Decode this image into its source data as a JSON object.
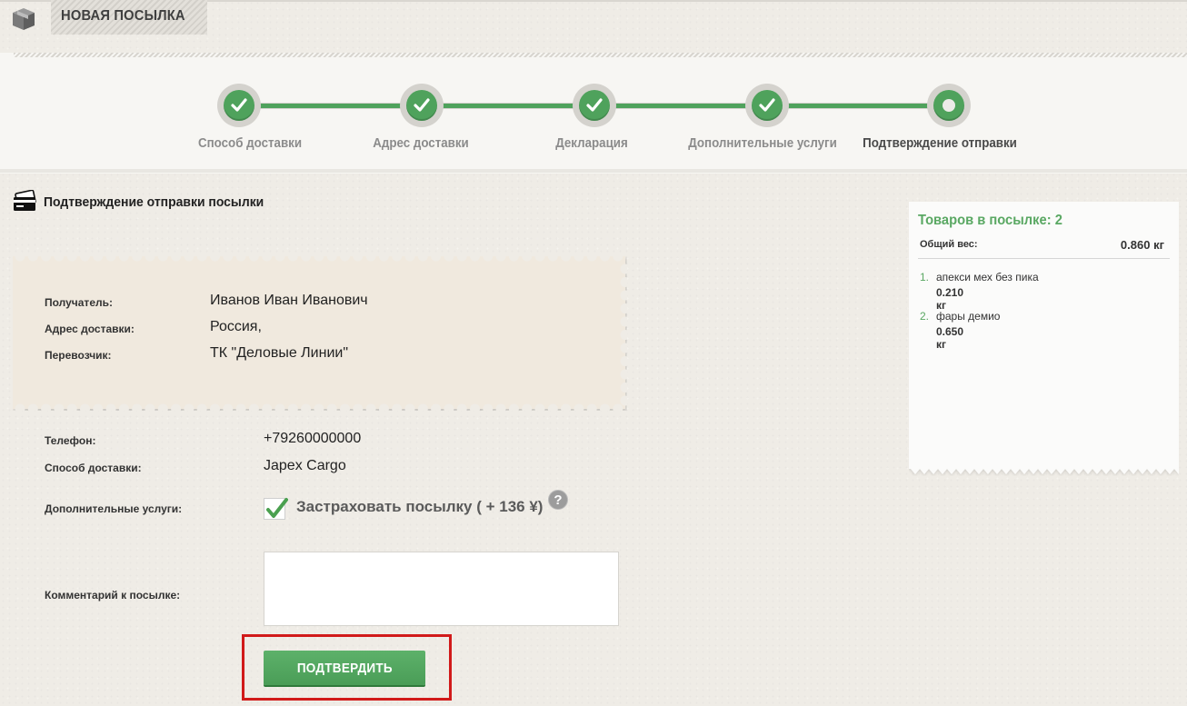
{
  "header": {
    "title": "НОВАЯ ПОСЫЛКА"
  },
  "steps": [
    {
      "label": "Способ доставки",
      "completed": true
    },
    {
      "label": "Адрес доставки",
      "completed": true
    },
    {
      "label": "Декларация",
      "completed": true
    },
    {
      "label": "Дополнительные услуги",
      "completed": true
    },
    {
      "label": "Подтверждение отправки",
      "completed": false,
      "current": true
    }
  ],
  "section": {
    "title": "Подтверждение отправки посылки"
  },
  "recipient": {
    "recipient_label": "Получатель:",
    "recipient_value": "Иванов Иван Иванович",
    "address_label": "Адрес доставки:",
    "address_value": "Россия,",
    "carrier_label": "Перевозчик:",
    "carrier_value": "ТК \"Деловые Линии\""
  },
  "details": {
    "phone_label": "Телефон:",
    "phone_value": "+79260000000",
    "delivery_label": "Способ доставки:",
    "delivery_value": "Japex Cargo",
    "services_label": "Дополнительные услуги:",
    "insure_label": "Застраховать посылку ( + 136 ¥)",
    "insure_checked": true,
    "help_symbol": "?",
    "comment_label": "Комментарий к посылке:",
    "comment_value": ""
  },
  "confirm_button": {
    "label": "ПОДТВЕРДИТЬ"
  },
  "cart": {
    "title": "Товаров в посылке: 2",
    "weight_label": "Общий вес:",
    "weight_value": "0.860 кг",
    "items": [
      {
        "num": "1.",
        "name": "апекси мех без пика",
        "weight": "0.210 кг"
      },
      {
        "num": "2.",
        "name": "фары демио",
        "weight": "0.650 кг"
      }
    ]
  },
  "colors": {
    "accent_green": "#4fa25c",
    "highlight_red": "#d11a1a",
    "stamp_bg": "#f0e9de"
  }
}
